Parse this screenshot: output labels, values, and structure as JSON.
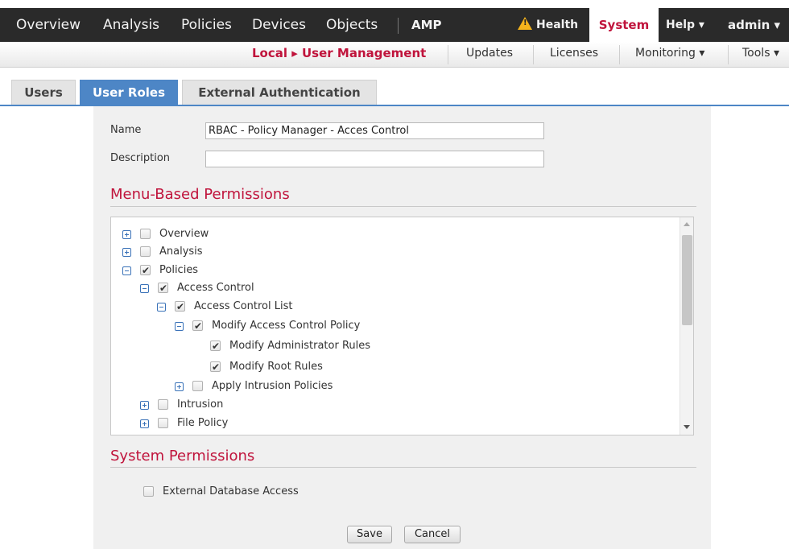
{
  "topnav": {
    "items": [
      "Overview",
      "Analysis",
      "Policies",
      "Devices",
      "Objects",
      "AMP"
    ],
    "health": "Health",
    "system": "System",
    "help": "Help ▾",
    "admin": "admin ▾"
  },
  "subnav": {
    "breadcrumb": "Local ▸ User Management",
    "items": [
      "Updates",
      "Licenses",
      "Monitoring ▾",
      "Tools ▾"
    ]
  },
  "tabs": {
    "users": "Users",
    "user_roles": "User Roles",
    "external_auth": "External Authentication"
  },
  "form": {
    "name_label": "Name",
    "name_value": "RBAC - Policy Manager - Acces Control",
    "description_label": "Description",
    "description_value": ""
  },
  "menu_permissions": {
    "title": "Menu-Based Permissions",
    "tree": [
      {
        "label": "Overview",
        "expander": "plus",
        "checked": false
      },
      {
        "label": "Analysis",
        "expander": "plus",
        "checked": false
      },
      {
        "label": "Policies",
        "expander": "minus",
        "checked": true
      },
      {
        "label": "Access Control",
        "expander": "minus",
        "checked": true
      },
      {
        "label": "Access Control List",
        "expander": "minus",
        "checked": true
      },
      {
        "label": "Modify Access Control Policy",
        "expander": "minus",
        "checked": true
      },
      {
        "label": "Modify Administrator Rules",
        "expander": "none",
        "checked": true
      },
      {
        "label": "Modify Root Rules",
        "expander": "none",
        "checked": true
      },
      {
        "label": "Apply Intrusion Policies",
        "expander": "plus",
        "checked": false
      },
      {
        "label": "Intrusion",
        "expander": "plus",
        "checked": false
      },
      {
        "label": "File Policy",
        "expander": "plus",
        "checked": false
      }
    ]
  },
  "system_permissions": {
    "title": "System Permissions",
    "external_db_label": "External Database Access",
    "external_db_checked": false
  },
  "buttons": {
    "save": "Save",
    "cancel": "Cancel"
  },
  "colors": {
    "accent": "#c0143c",
    "tab_active": "#4d86c6",
    "nav_bg": "#2a2a2a",
    "warning": "#f5b41c"
  }
}
